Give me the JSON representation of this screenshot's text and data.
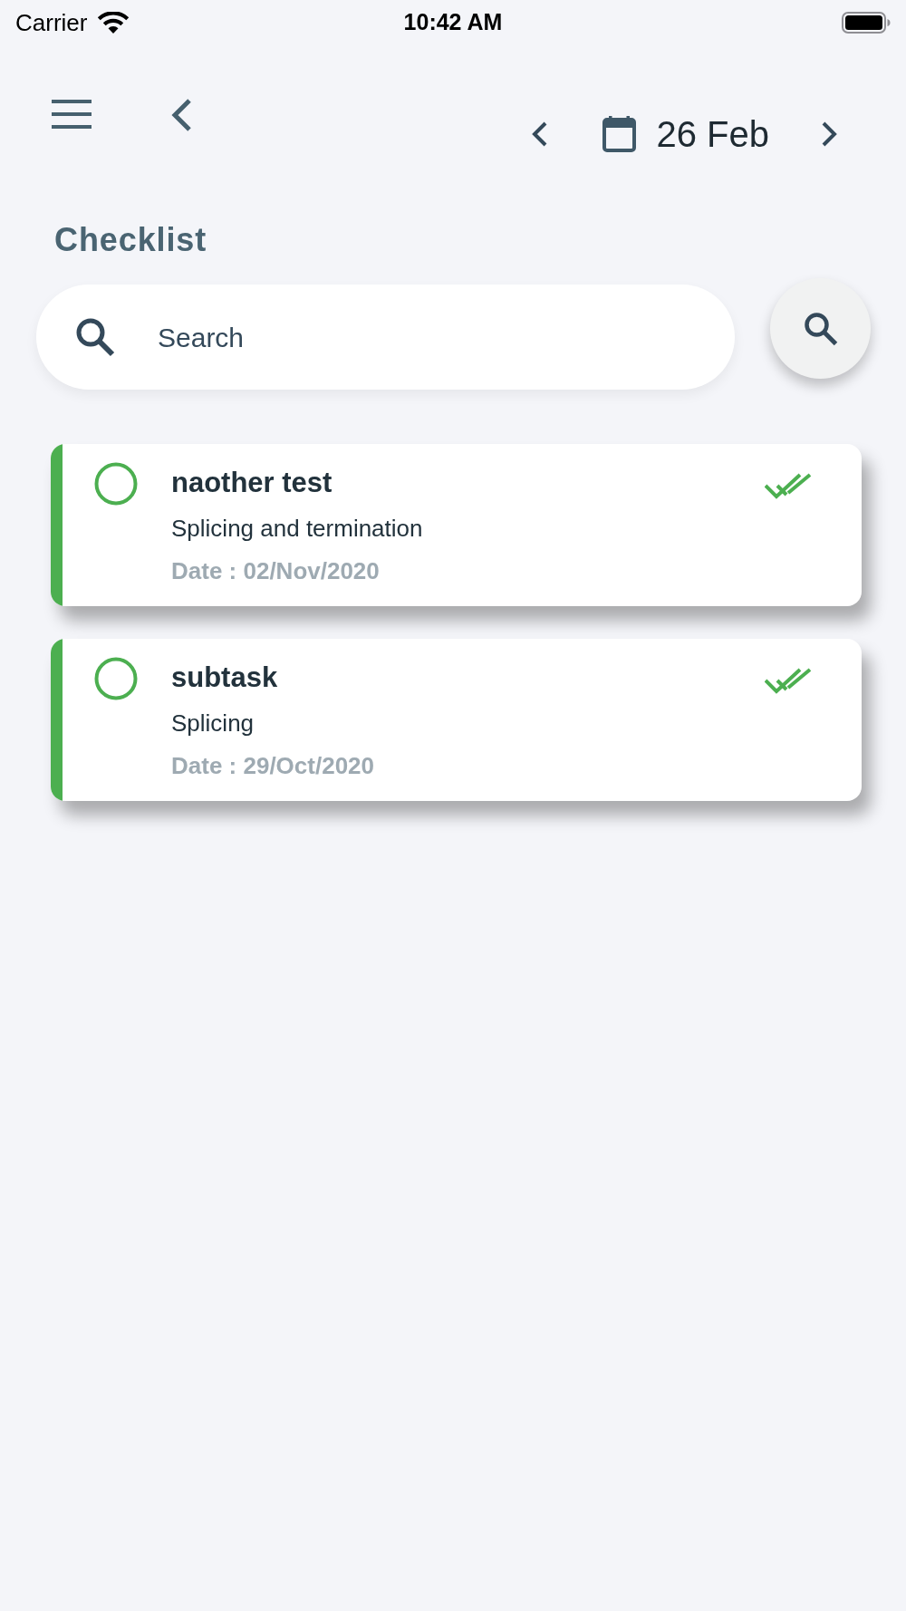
{
  "status_bar": {
    "carrier": "Carrier",
    "time": "10:42 AM"
  },
  "header": {
    "date": "26 Feb"
  },
  "title": "Checklist",
  "search": {
    "placeholder": "Search"
  },
  "tasks": [
    {
      "title": "naother test",
      "subtitle": "Splicing and termination",
      "date": "Date : 02/Nov/2020",
      "checked": false,
      "color": "#4caf50"
    },
    {
      "title": "subtask",
      "subtitle": "Splicing",
      "date": "Date : 29/Oct/2020",
      "checked": false,
      "color": "#4caf50"
    }
  ]
}
